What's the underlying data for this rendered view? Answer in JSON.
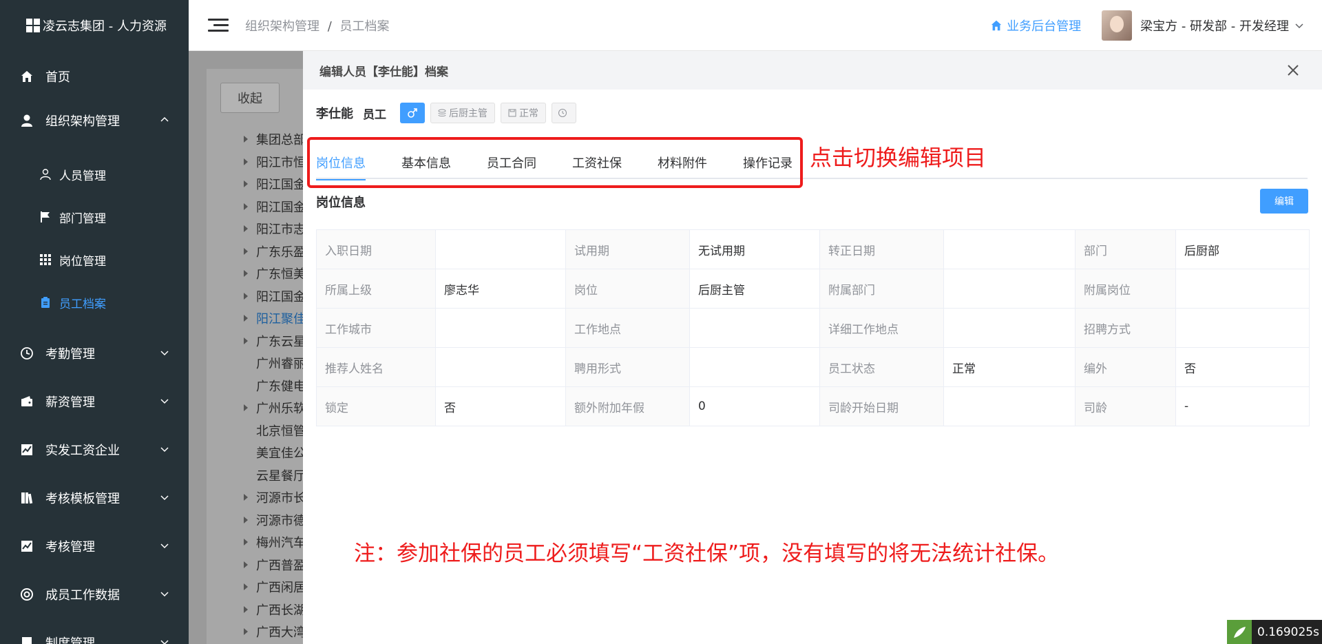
{
  "sidebar": {
    "brand": "凌云志集团 - 人力资源",
    "items": [
      {
        "label": "首页",
        "icon": "home-icon"
      },
      {
        "label": "组织架构管理",
        "icon": "user-icon"
      },
      {
        "label": "考勤管理",
        "icon": "clock-icon"
      },
      {
        "label": "薪资管理",
        "icon": "wallet-icon"
      },
      {
        "label": "实发工资企业",
        "icon": "chart-icon"
      },
      {
        "label": "考核模板管理",
        "icon": "book-icon"
      },
      {
        "label": "考核管理",
        "icon": "chart-icon"
      },
      {
        "label": "成员工作数据",
        "icon": "lifebuoy-icon"
      },
      {
        "label": "制度管理",
        "icon": "doc-icon"
      }
    ],
    "submenu": [
      {
        "label": "人员管理",
        "icon": "person-outline-icon"
      },
      {
        "label": "部门管理",
        "icon": "flag-icon"
      },
      {
        "label": "岗位管理",
        "icon": "grid-icon"
      },
      {
        "label": "员工档案",
        "icon": "clipboard-icon"
      }
    ]
  },
  "header": {
    "breadcrumb_1": "组织架构管理",
    "breadcrumb_sep": "/",
    "breadcrumb_2": "员工档案",
    "biz_link": "业务后台管理",
    "user": "梁宝方 - 研发部 - 开发经理"
  },
  "background": {
    "collapse": "收起",
    "tree": [
      "集团总部",
      "阳江市恒",
      "阳江国金",
      "阳江国金",
      "阳江市志",
      "广东乐盈",
      "广东恒美",
      "阳江国金",
      "阳江聚佳",
      "广东云星",
      "广州睿丽",
      "广东健电",
      "广州乐软",
      "北京恒管",
      "美宜佳公",
      "云星餐厅",
      "河源市长",
      "河源市德",
      "梅州汽车",
      "广西普盈",
      "广西闲居",
      "广西长湖",
      "广西大湾"
    ]
  },
  "drawer": {
    "title": "编辑人员【李仕能】档案",
    "name": "李仕能",
    "role": "员工",
    "tag_position": "后厨主管",
    "tag_status": "正常",
    "tabs": [
      "岗位信息",
      "基本信息",
      "员工合同",
      "工资社保",
      "材料附件",
      "操作记录"
    ],
    "section_title": "岗位信息",
    "edit_btn": "编辑",
    "table": [
      [
        "入职日期",
        "",
        "试用期",
        "无试用期",
        "转正日期",
        "",
        "部门",
        "后厨部"
      ],
      [
        "所属上级",
        "廖志华",
        "岗位",
        "后厨主管",
        "附属部门",
        "",
        "附属岗位",
        ""
      ],
      [
        "工作城市",
        "",
        "工作地点",
        "",
        "详细工作地点",
        "",
        "招聘方式",
        ""
      ],
      [
        "推荐人姓名",
        "",
        "聘用形式",
        "",
        "员工状态",
        "正常",
        "编外",
        "否"
      ],
      [
        "锁定",
        "否",
        "额外附加年假",
        "0",
        "司龄开始日期",
        "",
        "司龄",
        "-"
      ]
    ]
  },
  "annotations": {
    "note_tabs": "点击切换编辑项目",
    "note_social": "注：参加社保的员工必须填写“工资社保”项，没有填写的将无法统计社保。"
  },
  "timer": "0.169025s",
  "colors": {
    "sidebar": "#263238",
    "accent": "#409eff",
    "annotation": "#ee1c1c"
  }
}
